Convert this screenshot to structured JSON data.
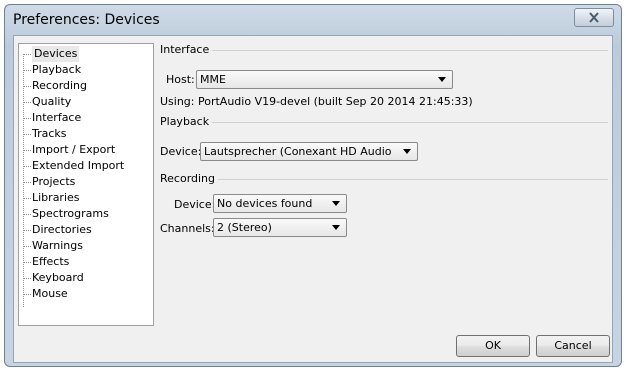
{
  "window": {
    "title": "Preferences: Devices"
  },
  "sidebar": {
    "items": [
      {
        "label": "Devices",
        "selected": true
      },
      {
        "label": "Playback"
      },
      {
        "label": "Recording"
      },
      {
        "label": "Quality"
      },
      {
        "label": "Interface"
      },
      {
        "label": "Tracks"
      },
      {
        "label": "Import / Export"
      },
      {
        "label": "Extended Import"
      },
      {
        "label": "Projects"
      },
      {
        "label": "Libraries"
      },
      {
        "label": "Spectrograms"
      },
      {
        "label": "Directories"
      },
      {
        "label": "Warnings"
      },
      {
        "label": "Effects"
      },
      {
        "label": "Keyboard"
      },
      {
        "label": "Mouse"
      }
    ]
  },
  "interface": {
    "heading": "Interface",
    "host_label": "Host:",
    "host_value": "MME",
    "using_text": "Using: PortAudio V19-devel (built Sep 20 2014 21:45:33)"
  },
  "playback": {
    "heading": "Playback",
    "device_label": "Device:",
    "device_value": "Lautsprecher (Conexant HD Audio"
  },
  "recording": {
    "heading": "Recording",
    "device_label": "Device:",
    "device_value": "No devices found",
    "channels_label": "Channels:",
    "channels_value": "2 (Stereo)"
  },
  "buttons": {
    "ok": "OK",
    "cancel": "Cancel"
  },
  "icons": {
    "close": "close-icon",
    "dropdown": "chevron-down-icon"
  }
}
